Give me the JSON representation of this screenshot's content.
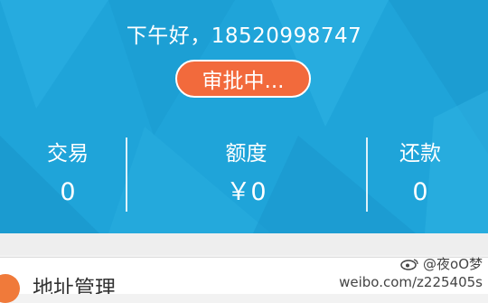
{
  "header": {
    "greeting": "下午好，18520998747",
    "status_button": "审批中..."
  },
  "stats": [
    {
      "label": "交易",
      "value": "0"
    },
    {
      "label": "额度",
      "value": "￥0"
    },
    {
      "label": "还款",
      "value": "0"
    }
  ],
  "card": {
    "icon": "orange-circle-icon",
    "title": "地址管理"
  },
  "watermark": {
    "handle": "@夜oO梦",
    "url": "weibo.com/z225405s"
  },
  "colors": {
    "hero_background": "#1fa4d9",
    "status_button": "#f26a3c"
  }
}
